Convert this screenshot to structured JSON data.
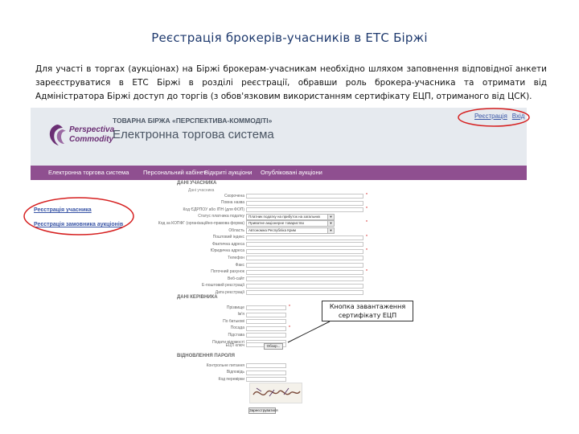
{
  "slide": {
    "title": "Реєстрація брокерів-учасників в ЕТС Біржі",
    "paragraph": "Для участі в торгах (аукціонах) на Біржі брокерам-учасникам необхідно шляхом заповнення відповідної анкети зареєструватися в ЕТС Біржі в розділі реєстрації, обравши роль брокера-учасника та отримати від Адміністратора Біржі доступ до торгів (з обов'язковим використанням сертифікату ЕЦП, отриманого від ЦСК)."
  },
  "header": {
    "logo_line1": "Perspectiva",
    "logo_line2": "Commodity",
    "exchange_name": "ТОВАРНА БІРЖА «ПЕРСПЕКТИВА-КОММОДІТІ»",
    "system_name": "Електронна торгова система",
    "link_register": "Реєстрація",
    "link_login": "Вхід"
  },
  "nav": {
    "items": [
      "Електронна торгова система",
      "Персональний кабінет",
      "Відкриті аукціони",
      "Опубліковані аукціони"
    ]
  },
  "sidebar": {
    "register_participant": "Реєстрація учасника",
    "register_customer": "Реєстрація замовника аукціонів"
  },
  "form": {
    "section_participant": "ДАНІ УЧАСНИКА",
    "section_participant_sub": "Дані учасника",
    "participant_fields": [
      {
        "label": "Скорочена",
        "kind": "input",
        "required": true
      },
      {
        "label": "Повна назва",
        "kind": "input",
        "required": false
      },
      {
        "label": "Код ЄДРПОУ або ІПН (для ФОП)",
        "kind": "input",
        "required": true
      },
      {
        "label": "Статус платника податку",
        "kind": "select",
        "value": "Платник податку на прибуток на загальних",
        "required": false
      },
      {
        "label": "Код за КОПФГ (організаційно-правова форма)",
        "kind": "select",
        "value": "Приватне акціонерне товариство",
        "required": true
      },
      {
        "label": "Область",
        "kind": "select",
        "value": "Автономна Республіка Крим",
        "required": false
      },
      {
        "label": "Поштовий індекс",
        "kind": "input",
        "required": true
      },
      {
        "label": "Фактична адреса",
        "kind": "input",
        "required": false
      },
      {
        "label": "Юридична адреса",
        "kind": "input",
        "required": true
      },
      {
        "label": "Телефон",
        "kind": "input",
        "required": false
      },
      {
        "label": "Факс",
        "kind": "input",
        "required": false
      },
      {
        "label": "Поточний рахунок",
        "kind": "input",
        "required": true
      },
      {
        "label": "Веб-сайт",
        "kind": "input",
        "required": false
      },
      {
        "label": "Е-поштовий реєстрації",
        "kind": "input",
        "required": false
      },
      {
        "label": "Дата реєстрації",
        "kind": "input",
        "required": false
      }
    ],
    "section_manager": "ДАНІ КЕРІВНИКА",
    "manager_fields": [
      {
        "label": "Прізвище",
        "required": true
      },
      {
        "label": "Ім'я",
        "required": false
      },
      {
        "label": "По батькові",
        "required": false
      },
      {
        "label": "Посада",
        "required": true
      },
      {
        "label": "Підстава",
        "required": false
      },
      {
        "label": "Подати відомості",
        "required": false
      }
    ],
    "certificate_label": "ЕЦП ключ",
    "browse_label": "Обзор...",
    "section_password": "ВІДНОВЛЕННЯ ПАРОЛЯ",
    "password_fields": [
      {
        "label": "Контрольне питання"
      },
      {
        "label": "Відповідь"
      },
      {
        "label": "Код перевірки"
      }
    ],
    "register_button": "Зареєструватися"
  },
  "callout": {
    "text": "Кнопка завантаження сертифікату ЕЦП"
  },
  "colors": {
    "title": "#1f3a6e",
    "nav": "#8f4f90",
    "header_bg": "#e6eaef",
    "annotation_red": "#d62020",
    "link": "#3955a6"
  }
}
